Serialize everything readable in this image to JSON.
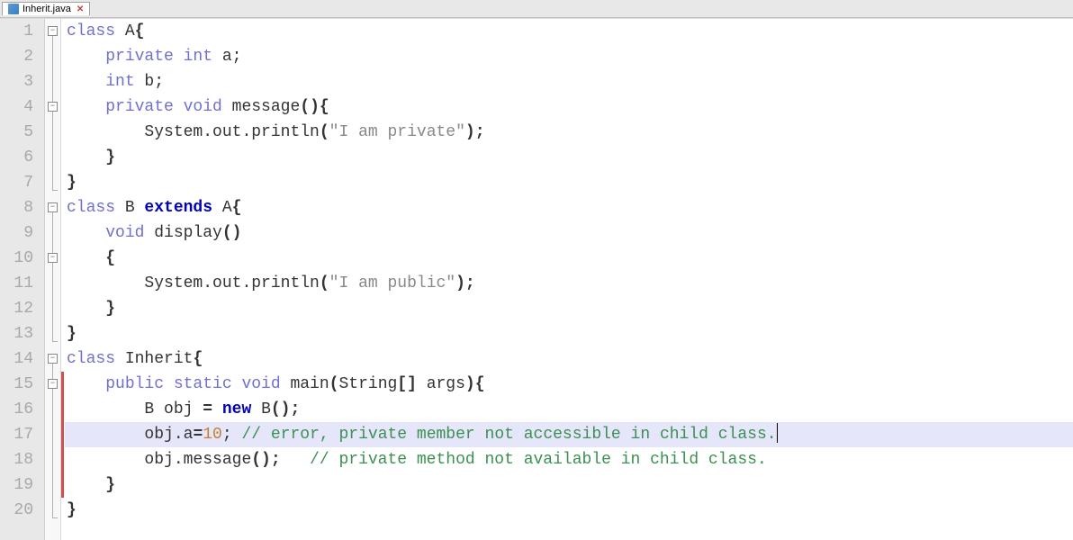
{
  "tab": {
    "filename": "Inherit.java",
    "close": "✕"
  },
  "lines": {
    "n1": "1",
    "n2": "2",
    "n3": "3",
    "n4": "4",
    "n5": "5",
    "n6": "6",
    "n7": "7",
    "n8": "8",
    "n9": "9",
    "n10": "10",
    "n11": "11",
    "n12": "12",
    "n13": "13",
    "n14": "14",
    "n15": "15",
    "n16": "16",
    "n17": "17",
    "n18": "18",
    "n19": "19",
    "n20": "20"
  },
  "code": {
    "l1": {
      "kw_class": "class",
      "name": " A",
      "brace": "{"
    },
    "l2": {
      "indent": "    ",
      "kw": "private int",
      "rest": " a;"
    },
    "l3": {
      "indent": "    ",
      "kw": "int",
      "rest": " b;"
    },
    "l4": {
      "indent": "    ",
      "kw": "private void",
      "name": " message",
      "paren": "(){"
    },
    "l5": {
      "indent": "        ",
      "call": "System.out.println",
      "po": "(",
      "str": "\"I am private\"",
      "pc": ");"
    },
    "l6": {
      "indent": "    ",
      "brace": "}"
    },
    "l7": {
      "brace": "}"
    },
    "l8": {
      "kw_class": "class",
      "name": " B ",
      "kw_ext": "extends",
      "name2": " A",
      "brace": "{"
    },
    "l9": {
      "indent": "    ",
      "kw": "void",
      "name": " display",
      "paren": "()"
    },
    "l10": {
      "indent": "    ",
      "brace": "{"
    },
    "l11": {
      "indent": "        ",
      "call": "System.out.println",
      "po": "(",
      "str": "\"I am public\"",
      "pc": ");"
    },
    "l12": {
      "indent": "    ",
      "brace": "}"
    },
    "l13": {
      "brace": "}"
    },
    "l14": {
      "kw_class": "class",
      "name": " Inherit",
      "brace": "{"
    },
    "l15": {
      "indent": "    ",
      "kw": "public static void",
      "name": " main",
      "po": "(",
      "arg": "String",
      "br": "[]",
      "arg2": " args",
      "pc": "){"
    },
    "l16": {
      "indent": "        ",
      "t1": "B obj ",
      "eq": "=",
      "sp": " ",
      "kw": "new",
      "t2": " B",
      "paren": "();"
    },
    "l17": {
      "indent": "        ",
      "t1": "obj.a",
      "eq": "=",
      "num": "10",
      "semi": "; ",
      "cmt": "// error, private member not accessible in child class."
    },
    "l18": {
      "indent": "        ",
      "t1": "obj.message",
      "paren": "();",
      "sp": "   ",
      "cmt": "// private method not available in child class."
    },
    "l19": {
      "indent": "    ",
      "brace": "}"
    },
    "l20": {
      "brace": "}"
    }
  },
  "fold": {
    "minus": "−"
  }
}
